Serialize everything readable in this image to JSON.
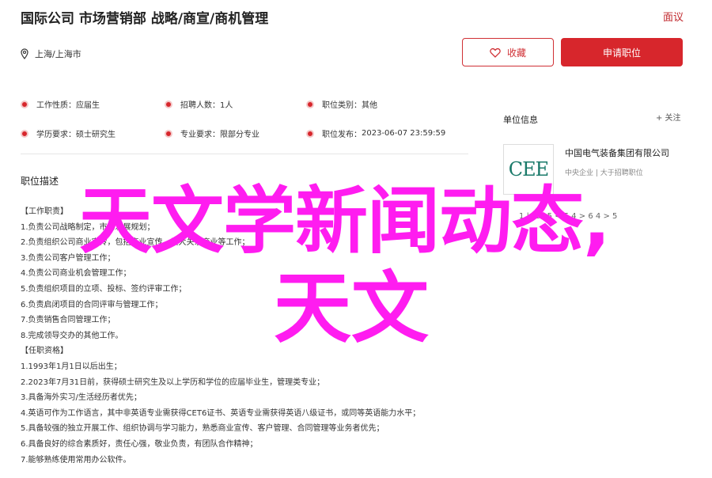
{
  "header": {
    "title": "国际公司 市场营销部 战略/商宣/商机管理",
    "report_label": "面议",
    "location": "上海/上海市",
    "favorite_label": "收藏",
    "apply_label": "申请职位"
  },
  "info_rows": [
    [
      {
        "label": "工作性质：",
        "value": "应届生"
      },
      {
        "label": "招聘人数：",
        "value": "1人"
      },
      {
        "label": "职位类别：",
        "value": "其他"
      }
    ],
    [
      {
        "label": "学历要求：",
        "value": "硕士研究生"
      },
      {
        "label": "专业要求：",
        "value": "限部分专业"
      },
      {
        "label": "职位发布：",
        "value": "2023-06-07 23:59:59"
      }
    ]
  ],
  "description": {
    "title": "职位描述",
    "lines": [
      "【工作职责】",
      "1.负责公司战略制定，市场发展规划；",
      "2.负责组织公司商业宣传，包括商业宣传、重大关系商业等工作；",
      "3.负责公司客户管理工作；",
      "4.负责公司商业机会管理工作；",
      "5.负责组织项目的立项、投标、签约评审工作；",
      "6.负责启闭项目的合同评审与管理工作；",
      "7.负责销售合同管理工作；",
      "8.完成领导交办的其他工作。",
      "【任职资格】",
      "1.1993年1月1日以后出生；",
      "2.2023年7月31日前，获得硕士研究生及以上学历和学位的应届毕业生，管理类专业；",
      "3.具备海外实习/生活经历者优先；",
      "4.英语可作为工作语言，其中非英语专业需获得CET6证书、英语专业需获得英语八级证书，或同等英语能力水平；",
      "5.具备较强的独立开展工作、组织协调与学习能力，熟悉商业宣传、客户管理、合同管理等业务者优先；",
      "6.具备良好的综合素质好，责任心强，敬业负责，有团队合作精神；",
      "7.能够熟练使用常用办公软件。"
    ]
  },
  "sidebar": {
    "title": "单位信息",
    "follow_label": "+ 关注",
    "logo_text": "CEE",
    "company_name": "中国电气装备集团有限公司",
    "company_sub": "中央企业 | 大于招聘职位",
    "company_sub2": "1 | 工 · 5 < 5 4 > 6 4 > 5"
  },
  "overlay": {
    "line1": "天文学新闻动态,",
    "line2": "天文"
  },
  "colors": {
    "accent": "#d7262c",
    "overlay": "#ff1cf0"
  }
}
